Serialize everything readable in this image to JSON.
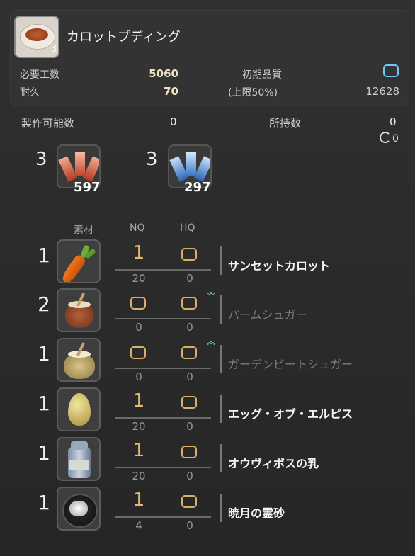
{
  "item": {
    "name": "カロットプディング",
    "quantity": "3",
    "icon": "custard-pudding-icon"
  },
  "stats": {
    "required_progress_label": "必要工数",
    "required_progress_value": "5060",
    "durability_label": "耐久",
    "durability_value": "70",
    "initial_quality_label": "初期品質",
    "max_quality_label": "(上限50%)",
    "max_quality_value": "12628"
  },
  "craftable": {
    "label": "製作可能数",
    "value": "0"
  },
  "owned": {
    "label": "所持数",
    "value": "0",
    "hq_value": "0"
  },
  "crystals": [
    {
      "required": "3",
      "stock": "597",
      "icon": "fire-crystal-icon",
      "color": "#e07050"
    },
    {
      "required": "3",
      "stock": "297",
      "icon": "ice-crystal-icon",
      "color": "#6fa8e8"
    }
  ],
  "columns": {
    "material": "素材",
    "nq": "NQ",
    "hq": "HQ"
  },
  "materials": [
    {
      "required": "1",
      "nq": "1",
      "nq_have": "20",
      "hq_have": "0",
      "name": "サンセットカロット",
      "available": true,
      "hq_arrow": false,
      "icon": "carrot-icon"
    },
    {
      "required": "2",
      "nq": "",
      "nq_have": "0",
      "hq_have": "0",
      "name": "パームシュガー",
      "available": false,
      "hq_arrow": true,
      "icon": "palm-sugar-jar-icon"
    },
    {
      "required": "1",
      "nq": "",
      "nq_have": "0",
      "hq_have": "0",
      "name": "ガーデンビートシュガー",
      "available": false,
      "hq_arrow": true,
      "icon": "beet-sugar-pot-icon"
    },
    {
      "required": "1",
      "nq": "1",
      "nq_have": "20",
      "hq_have": "0",
      "name": "エッグ・オブ・エルピス",
      "available": true,
      "hq_arrow": false,
      "icon": "egg-icon"
    },
    {
      "required": "1",
      "nq": "1",
      "nq_have": "20",
      "hq_have": "0",
      "name": "オウヴィボスの乳",
      "available": true,
      "hq_arrow": false,
      "icon": "milk-can-icon"
    },
    {
      "required": "1",
      "nq": "1",
      "nq_have": "4",
      "hq_have": "0",
      "name": "暁月の霊砂",
      "available": true,
      "hq_arrow": false,
      "icon": "aethersand-icon"
    }
  ],
  "colors": {
    "accent": "#e5b86c",
    "quality": "#6ec6f2",
    "hq_arrow": "#7fd3e8"
  }
}
